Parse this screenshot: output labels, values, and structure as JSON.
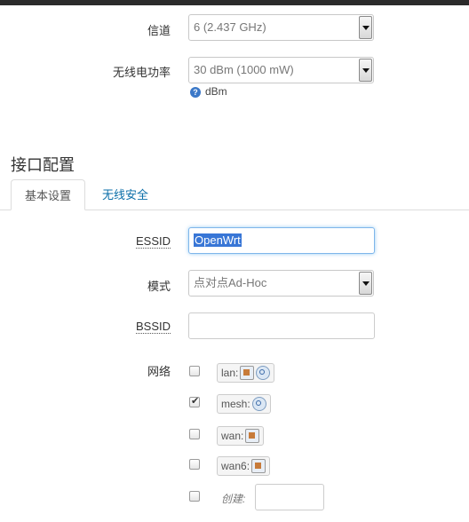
{
  "device": {
    "channel_label": "信道",
    "channel_value": "6 (2.437 GHz)",
    "txpower_label": "无线电功率",
    "txpower_value": "30 dBm (1000 mW)",
    "txpower_help": "dBm"
  },
  "section_title": "接口配置",
  "tabs": [
    {
      "label": "基本设置",
      "active": true
    },
    {
      "label": "无线安全",
      "active": false
    }
  ],
  "form": {
    "essid_label": "ESSID",
    "essid_value": "OpenWrt",
    "mode_label": "模式",
    "mode_value": "点对点Ad-Hoc",
    "bssid_label": "BSSID",
    "bssid_value": "",
    "network_label": "网络",
    "networks": [
      {
        "name": "lan:",
        "checked": false,
        "icons": [
          "ethernet-icon",
          "wifi-icon"
        ]
      },
      {
        "name": "mesh:",
        "checked": true,
        "icons": [
          "wifi-icon"
        ]
      },
      {
        "name": "wan:",
        "checked": false,
        "icons": [
          "ethernet-icon"
        ]
      },
      {
        "name": "wan6:",
        "checked": false,
        "icons": [
          "ethernet-icon"
        ]
      }
    ],
    "create_label": "创建:",
    "create_value": ""
  }
}
